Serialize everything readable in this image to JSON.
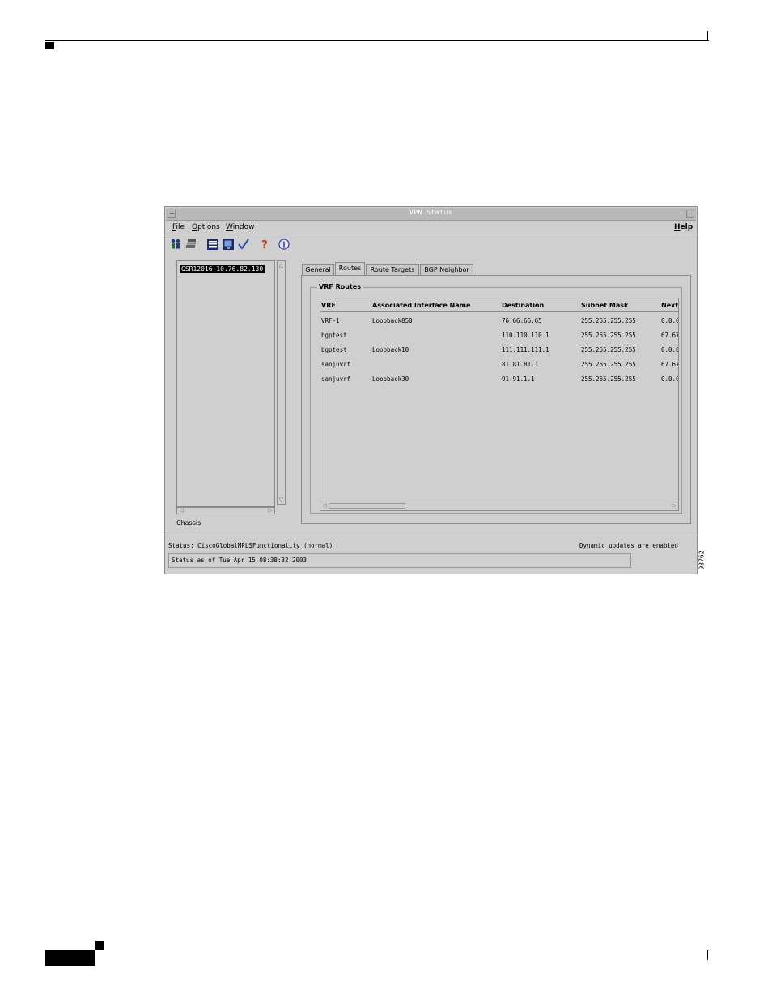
{
  "window": {
    "title": "VPN Status"
  },
  "menubar": {
    "file": "File",
    "options": "Options",
    "window": "Window",
    "help": "Help"
  },
  "toolbar": {
    "icons": [
      "users-icon",
      "layers-icon",
      "list-icon",
      "monitor-icon",
      "checkmark-icon",
      "help-icon",
      "info-icon"
    ]
  },
  "tree": {
    "selected_node": "GSR12016-10.76.82.130",
    "footer_label": "Chassis"
  },
  "tabs": [
    {
      "label": "General",
      "active": false
    },
    {
      "label": "Routes",
      "active": true
    },
    {
      "label": "Route Targets",
      "active": false
    },
    {
      "label": "BGP Neighbor",
      "active": false
    }
  ],
  "routes": {
    "group_title": "VRF Routes",
    "columns": [
      "VRF",
      "Associated Interface Name",
      "Destination",
      "Subnet Mask",
      "Next"
    ],
    "rows": [
      [
        "VRF-1",
        "Loopback850",
        "76.66.66.65",
        "255.255.255.255",
        "0.0.0"
      ],
      [
        "bgptest",
        "",
        "110.110.110.1",
        "255.255.255.255",
        "67.67"
      ],
      [
        "bgptest",
        "Loopback10",
        "111.111.111.1",
        "255.255.255.255",
        "0.0.0"
      ],
      [
        "sanjuvrf",
        "",
        "81.81.81.1",
        "255.255.255.255",
        "67.67"
      ],
      [
        "sanjuvrf",
        "Loopback30",
        "91.91.1.1",
        "255.255.255.255",
        "0.0.0"
      ]
    ]
  },
  "status": {
    "status_line": "Status: CiscoGlobalMPLSFunctionality (normal)",
    "dynamic_updates": "Dynamic updates are enabled",
    "status_as_of": "Status as of Tue Apr 15 08:38:32 2003"
  },
  "figure_number": "93762",
  "colors": {
    "window_bg": "#cfcfcf",
    "titlebar": "#b8b8b8",
    "selection": "#000000"
  }
}
